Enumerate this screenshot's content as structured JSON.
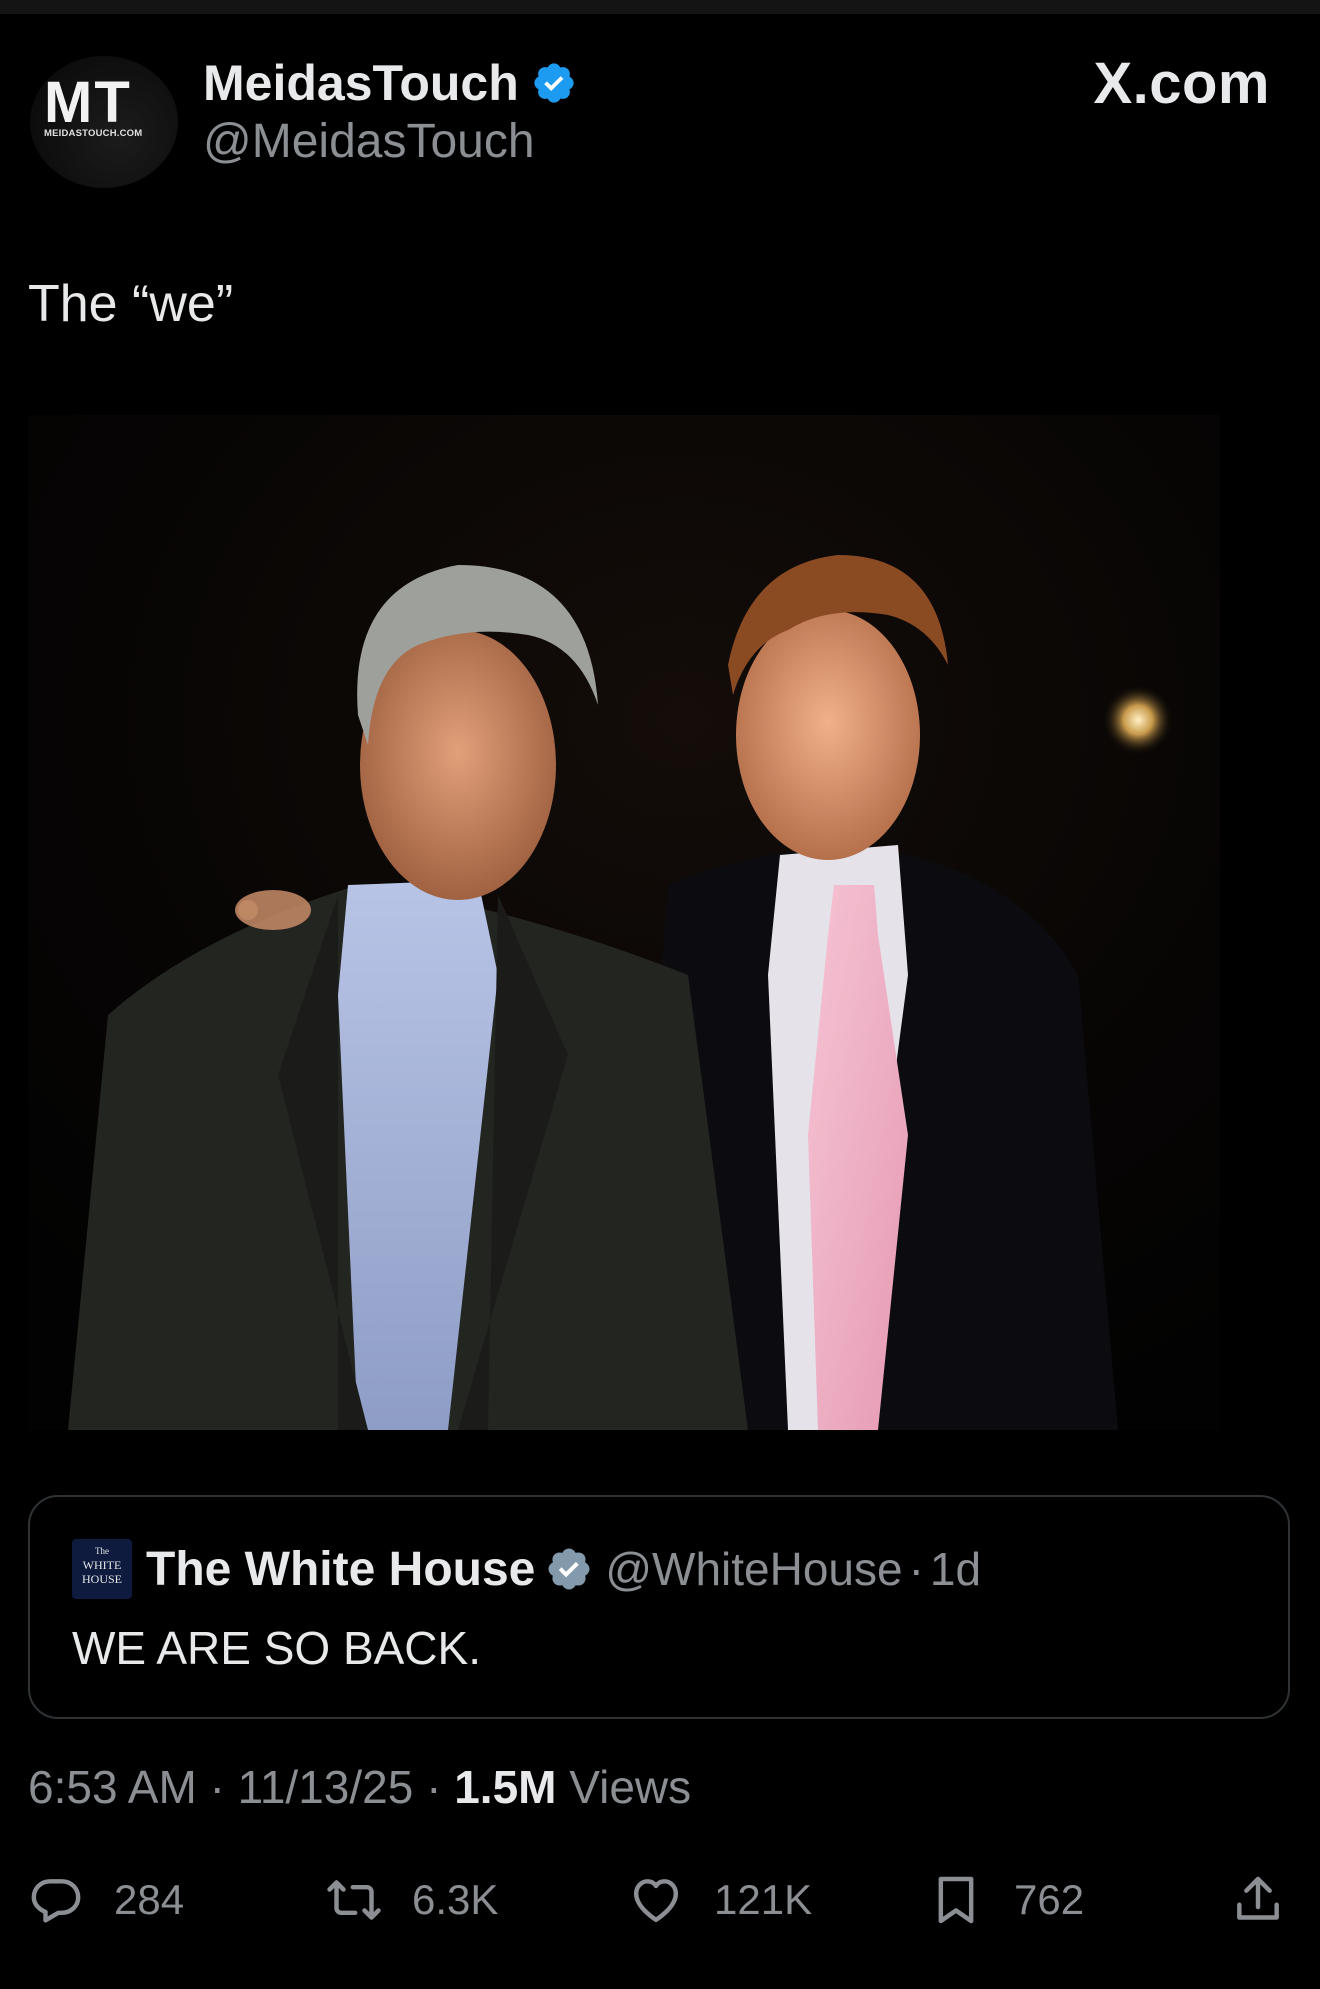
{
  "source": {
    "site": "X.com"
  },
  "author": {
    "avatar_text": "MT",
    "avatar_subtext": "MEIDASTOUCH.COM",
    "name": "MeidasTouch",
    "handle": "@MeidasTouch",
    "verified": true
  },
  "tweet": {
    "text": "The “we”",
    "media": {
      "type": "photo"
    }
  },
  "quote": {
    "avatar_lines": [
      "The",
      "WHITE",
      "HOUSE"
    ],
    "name": "The White House",
    "handle": "@WhiteHouse",
    "separator": "·",
    "time": "1d",
    "text": "WE ARE SO BACK.",
    "verified": true
  },
  "meta": {
    "time": "6:53 AM",
    "date": "11/13/25",
    "separator": "·",
    "views_count": "1.5M",
    "views_label": "Views"
  },
  "actions": {
    "replies": "284",
    "reposts": "6.3K",
    "likes": "121K",
    "bookmarks": "762"
  },
  "colors": {
    "background": "#000000",
    "text_primary": "#e7e9ea",
    "text_secondary": "#8b8f94",
    "verified_blue": "#1d9bf0",
    "border": "#2f3336"
  }
}
